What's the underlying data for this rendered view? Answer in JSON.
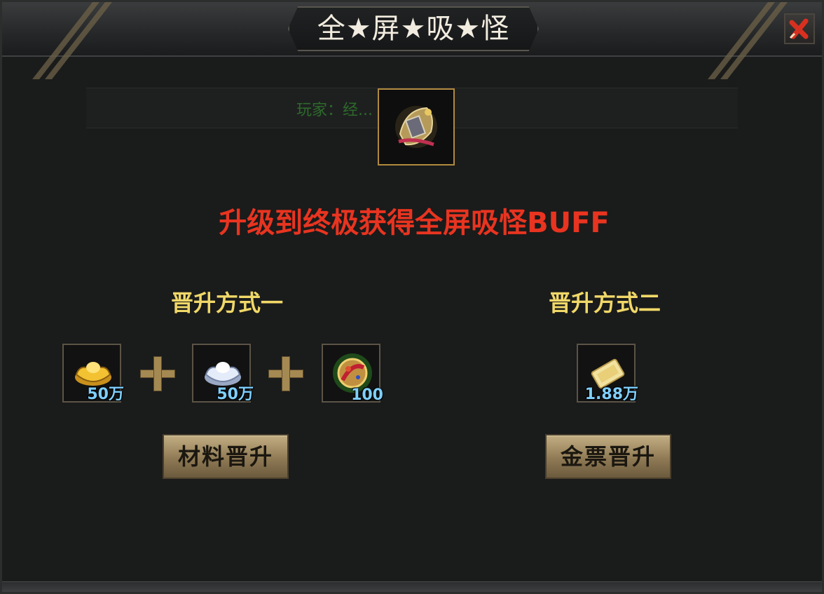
{
  "window": {
    "title": "全★屏★吸★怪"
  },
  "notice": {
    "text": "玩家：经..."
  },
  "headline": "升级到终极获得全屏吸怪BUFF",
  "method_one": {
    "title": "晋升方式一",
    "materials": [
      {
        "icon": "gold-ingot-icon",
        "count": "50万"
      },
      {
        "icon": "silver-ingot-icon",
        "count": "50万"
      },
      {
        "icon": "orb-icon",
        "count": "100"
      }
    ],
    "button_label": "材料晋升"
  },
  "method_two": {
    "title": "晋升方式二",
    "materials": [
      {
        "icon": "gold-ticket-icon",
        "count": "1.88万"
      }
    ],
    "button_label": "金票晋升"
  },
  "colors": {
    "headline": "#e83420",
    "method_title": "#f0d868",
    "count": "#7fd0ff",
    "item_border": "#b08a3e"
  }
}
